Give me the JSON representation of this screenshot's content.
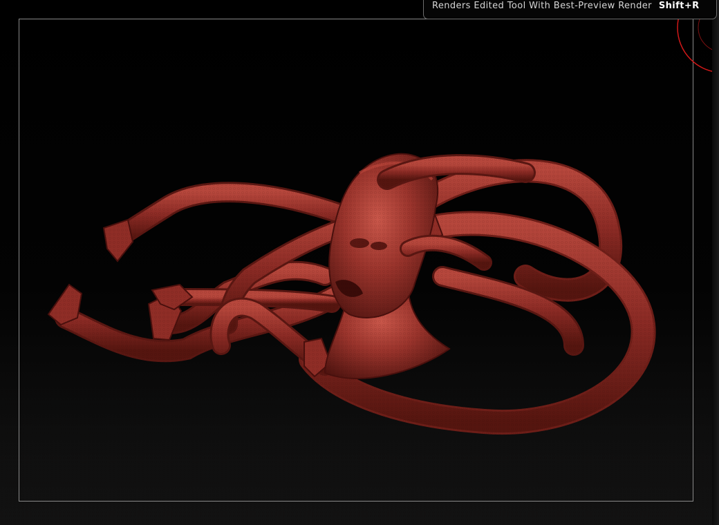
{
  "tooltip": {
    "description": "Renders Edited Tool With Best-Preview Render",
    "shortcut": "Shift+R"
  },
  "colors": {
    "model_base": "#8a2a24",
    "model_highlight": "#c24a3e",
    "model_shadow": "#4a100d",
    "frame_border": "#8a8a8a",
    "gizmo": "#d01818"
  },
  "icons": {
    "gizmo": "red-circle-gizmo-icon"
  }
}
